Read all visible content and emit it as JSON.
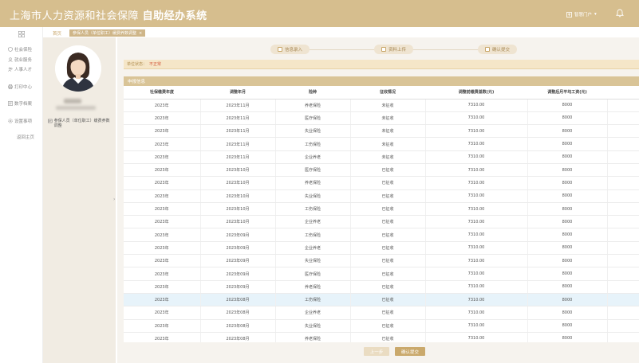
{
  "header": {
    "title_main": "上海市人力资源和社会保障",
    "title_sub": "自助经办系统",
    "portal_label": "智慧门户"
  },
  "nav": {
    "items": [
      {
        "label": "社会保险",
        "icon": "shield-icon"
      },
      {
        "label": "就业服务",
        "icon": "briefcase-icon"
      },
      {
        "label": "人事人才",
        "icon": "users-icon"
      },
      {
        "label": "打印中心",
        "icon": "printer-icon"
      },
      {
        "label": "数字档案",
        "icon": "folder-icon"
      },
      {
        "label": "设置事项",
        "icon": "gear-icon"
      },
      {
        "label": "返回主页",
        "icon": ""
      }
    ]
  },
  "tabs": {
    "home": "首页",
    "active": "参保人员（单位职工）缓费养数调整"
  },
  "profile": {
    "person_type": "参保人员（单位职工）缓费养数调整"
  },
  "steps": [
    {
      "label": "信息录入"
    },
    {
      "label": "资料上传"
    },
    {
      "label": "确认提交"
    }
  ],
  "notice": {
    "label": "单位状态：",
    "value": "不正常"
  },
  "section": {
    "title": "申报信息"
  },
  "table": {
    "headers": [
      "社保缴费年度",
      "调整年月",
      "险种",
      "征收情况",
      "调整前缴费基数(元)",
      "调整后月平均工资(元)",
      "调整后缴费基数(元)"
    ],
    "rows": [
      [
        "2023年",
        "2023年11月",
        "养老保险",
        "未征收",
        "7310.00",
        "8000",
        "8000"
      ],
      [
        "2023年",
        "2023年11月",
        "医疗保险",
        "未征收",
        "7310.00",
        "8000",
        "8000"
      ],
      [
        "2023年",
        "2023年11月",
        "失业保险",
        "未征收",
        "7310.00",
        "8000",
        "8000"
      ],
      [
        "2023年",
        "2023年11月",
        "工伤保险",
        "未征收",
        "7310.00",
        "8000",
        "8000"
      ],
      [
        "2023年",
        "2023年11月",
        "企业养老",
        "未征收",
        "7310.00",
        "8000",
        "8000"
      ],
      [
        "2023年",
        "2023年10月",
        "医疗保险",
        "已征收",
        "7310.00",
        "8000",
        "8000"
      ],
      [
        "2023年",
        "2023年10月",
        "养老保险",
        "已征收",
        "7310.00",
        "8000",
        "8000"
      ],
      [
        "2023年",
        "2023年10月",
        "失业保险",
        "已征收",
        "7310.00",
        "8000",
        "8000"
      ],
      [
        "2023年",
        "2023年10月",
        "工伤保险",
        "已征收",
        "7310.00",
        "8000",
        "8000"
      ],
      [
        "2023年",
        "2023年10月",
        "企业养老",
        "已征收",
        "7310.00",
        "8000",
        "8000"
      ],
      [
        "2023年",
        "2023年09月",
        "工伤保险",
        "已征收",
        "7310.00",
        "8000",
        "8000"
      ],
      [
        "2023年",
        "2023年09月",
        "企业养老",
        "已征收",
        "7310.00",
        "8000",
        "8000"
      ],
      [
        "2023年",
        "2023年09月",
        "失业保险",
        "已征收",
        "7310.00",
        "8000",
        "8000"
      ],
      [
        "2023年",
        "2023年09月",
        "医疗保险",
        "已征收",
        "7310.00",
        "8000",
        "8000"
      ],
      [
        "2023年",
        "2023年09月",
        "养老保险",
        "已征收",
        "7310.00",
        "8000",
        "8000"
      ],
      [
        "2023年",
        "2023年08月",
        "工伤保险",
        "已征收",
        "7310.00",
        "8000",
        "8000"
      ],
      [
        "2023年",
        "2023年08月",
        "企业养老",
        "已征收",
        "7310.00",
        "8000",
        "8000"
      ],
      [
        "2023年",
        "2023年08月",
        "失业保险",
        "已征收",
        "7310.00",
        "8000",
        "8000"
      ],
      [
        "2023年",
        "2023年08月",
        "养老保险",
        "已征收",
        "7310.00",
        "8000",
        "8000"
      ]
    ],
    "highlighted_row": 15
  },
  "buttons": {
    "prev": "上一步",
    "submit": "确认提交"
  },
  "colors": {
    "header": "#d6be8e",
    "accent": "#c9a76a",
    "section": "#d9c497",
    "notice_bg": "#f5e6c8",
    "warning": "#d45a3c",
    "row_highlight": "#e7f3fa"
  }
}
